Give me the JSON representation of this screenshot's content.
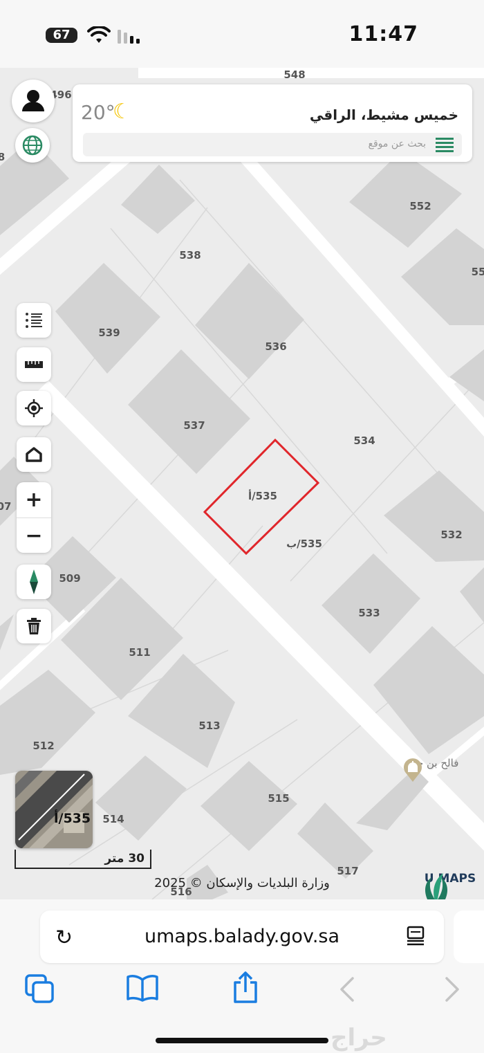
{
  "status_bar": {
    "time": "11:47",
    "battery": "67"
  },
  "header": {
    "city": "خميس مشيط، الراقي",
    "temperature": "20°",
    "search_placeholder": "بحث عن موقع"
  },
  "map": {
    "parcel_labels": [
      "548",
      "496",
      "8",
      "552",
      "538",
      "55",
      "539",
      "536",
      "537",
      "534",
      "535/أ",
      "07",
      "535/ب",
      "532",
      "509",
      "533",
      "511",
      "513",
      "512",
      "515",
      "514",
      "517",
      "516"
    ],
    "poi": {
      "name": "فالح بن جبار",
      "icon": "mosque-icon"
    },
    "highlight_color": "#e0262b",
    "thumbnail_label": "535/أ",
    "scale_label": "30 متر",
    "copyright": "وزارة البلديات والإسكان © 2025",
    "logo_text": "U MAPS"
  },
  "toolbar": {
    "icons": [
      "layers-list-icon",
      "ruler-icon",
      "locate-icon",
      "home-icon",
      "zoom-in-icon",
      "zoom-out-icon",
      "compass-icon",
      "trash-icon"
    ],
    "zoom_in": "+",
    "zoom_out": "−"
  },
  "browser": {
    "url": "umaps.balady.gov.sa",
    "watermark": "حراج"
  },
  "colors": {
    "accent": "#2a8a63",
    "block": "#d3d3d3",
    "road": "#ffffff",
    "lot": "#ececec"
  }
}
